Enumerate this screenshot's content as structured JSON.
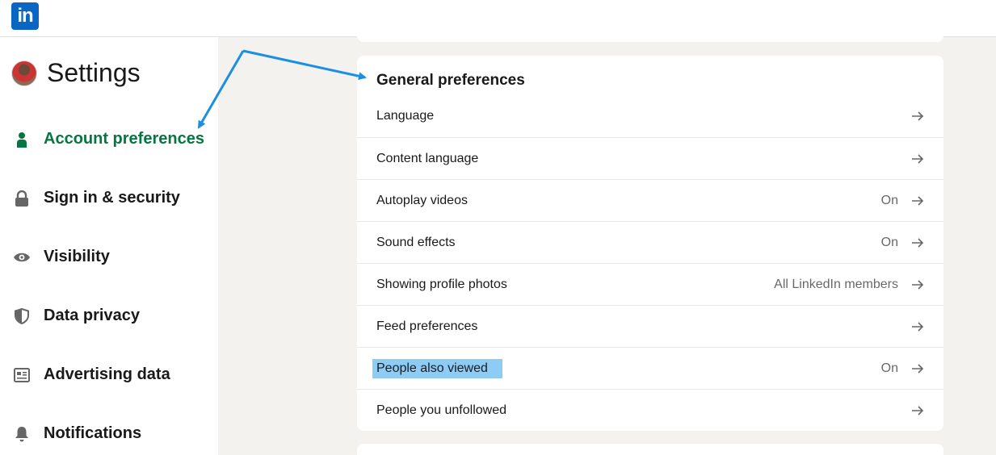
{
  "brand": {
    "logo_text": "in",
    "color": "#0a66c2"
  },
  "sidebar": {
    "title": "Settings",
    "active_color": "#057642",
    "items": [
      {
        "label": "Account preferences",
        "icon": "person-icon",
        "active": true
      },
      {
        "label": "Sign in & security",
        "icon": "lock-icon",
        "active": false
      },
      {
        "label": "Visibility",
        "icon": "eye-icon",
        "active": false
      },
      {
        "label": "Data privacy",
        "icon": "shield-icon",
        "active": false
      },
      {
        "label": "Advertising data",
        "icon": "newspaper-icon",
        "active": false
      },
      {
        "label": "Notifications",
        "icon": "bell-icon",
        "active": false
      }
    ]
  },
  "main": {
    "section_title": "General preferences",
    "rows": [
      {
        "label": "Language",
        "value": ""
      },
      {
        "label": "Content language",
        "value": ""
      },
      {
        "label": "Autoplay videos",
        "value": "On"
      },
      {
        "label": "Sound effects",
        "value": "On"
      },
      {
        "label": "Showing profile photos",
        "value": "All LinkedIn members"
      },
      {
        "label": "Feed preferences",
        "value": ""
      },
      {
        "label": "People also viewed",
        "value": "On",
        "highlighted": true
      },
      {
        "label": "People you unfollowed",
        "value": ""
      }
    ]
  },
  "annotation": {
    "arrow_color": "#1a8fe3",
    "highlight_color": "#8ecbf5"
  }
}
